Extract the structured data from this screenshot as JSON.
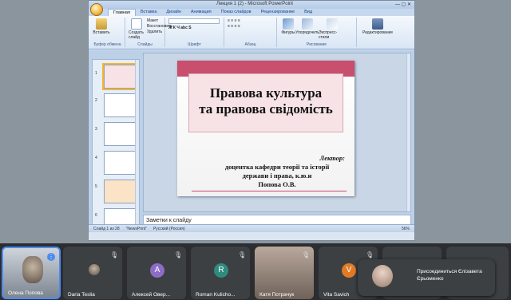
{
  "window": {
    "title": "Лекция 1 (2) - Microsoft PowerPoint",
    "tabs": [
      "Главная",
      "Вставка",
      "Дизайн",
      "Анимация",
      "Показ слайдов",
      "Рецензирование",
      "Вид"
    ],
    "active_tab": "Главная"
  },
  "ribbon": {
    "paste_label": "Вставить",
    "new_slide_label": "Создать слайд",
    "group_clipboard": "Буфер обмена",
    "group_slides": "Слайды",
    "group_font": "Шрифт",
    "group_paragraph": "Абзац",
    "group_drawing": "Рисование",
    "group_editing": "Редактирование",
    "layout_label": "Макет",
    "reset_label": "Восстановить",
    "delete_label": "Удалить",
    "shapes_label": "Фигуры",
    "arrange_label": "Упорядочить",
    "quick_styles_label": "Экспресс-стили",
    "editing_label": "Редактирование"
  },
  "slide": {
    "title_line1": "Правова культура",
    "title_line2": "та правова свідомість",
    "lecturer_label": "Лектор:",
    "line1": "доцентка кафедри теорії та історії",
    "line2": "держави і права, к.ю.н",
    "line3": "Попова О.В."
  },
  "thumbnail_numbers": [
    "1",
    "2",
    "3",
    "4",
    "5",
    "6"
  ],
  "notes_placeholder": "Заметки к слайду",
  "status": {
    "slide_info": "Слайд 1 из 28",
    "theme": "\"NewsPrint\"",
    "language": "Русский (Россия)",
    "zoom": "56%"
  },
  "participants": [
    {
      "name": "Олена Попова",
      "initial": "",
      "color": ""
    },
    {
      "name": "Daria Teslia",
      "initial": "",
      "color": ""
    },
    {
      "name": "Алексей Овер...",
      "initial": "А",
      "color": "#8e6cc5"
    },
    {
      "name": "Roman Kulicho...",
      "initial": "R",
      "color": "#2e8b7e"
    },
    {
      "name": "Катя Потрачук",
      "initial": "",
      "color": ""
    },
    {
      "name": "Vita Savich",
      "initial": "V",
      "color": "#e07b24"
    }
  ],
  "toast": {
    "line1": "Присоединиться Єлізавета",
    "line2": "Єрьоменко"
  }
}
